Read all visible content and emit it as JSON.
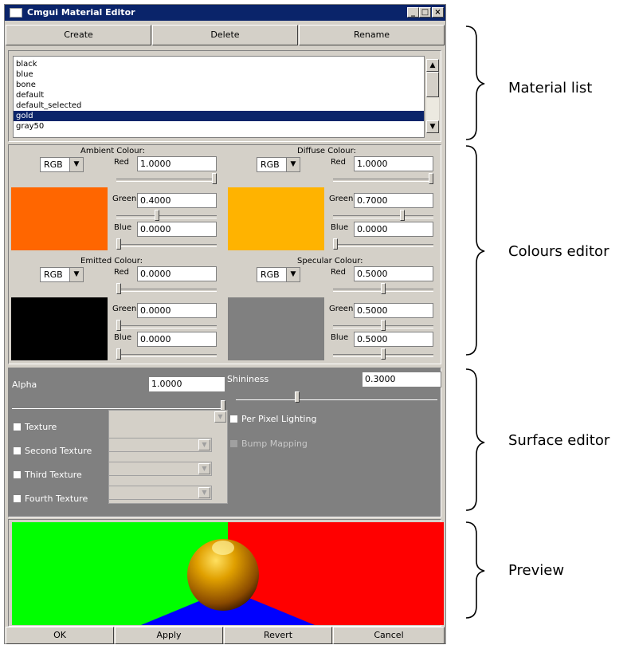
{
  "window": {
    "title": "Cmgui Material Editor",
    "min": "_",
    "max": "□",
    "close": "×"
  },
  "toolbar": {
    "create": "Create",
    "delete": "Delete",
    "rename": "Rename"
  },
  "materials": {
    "items": [
      "black",
      "blue",
      "bone",
      "default",
      "default_selected",
      "gold",
      "gray50"
    ],
    "selected": "gold"
  },
  "colours": {
    "ambient": {
      "title": "Ambient Colour:",
      "mode": "RGB",
      "red_label": "Red",
      "green_label": "Green",
      "blue_label": "Blue",
      "red": "1.0000",
      "green": "0.4000",
      "blue": "0.0000",
      "swatch": "#ff6600",
      "red_level": 1.0,
      "green_level": 0.4,
      "blue_level": 0.0
    },
    "diffuse": {
      "title": "Diffuse Colour:",
      "mode": "RGB",
      "red_label": "Red",
      "green_label": "Green",
      "blue_label": "Blue",
      "red": "1.0000",
      "green": "0.7000",
      "blue": "0.0000",
      "swatch": "#ffb300",
      "red_level": 1.0,
      "green_level": 0.7,
      "blue_level": 0.0
    },
    "emitted": {
      "title": "Emitted Colour:",
      "mode": "RGB",
      "red_label": "Red",
      "green_label": "Green",
      "blue_label": "Blue",
      "red": "0.0000",
      "green": "0.0000",
      "blue": "0.0000",
      "swatch": "#000000",
      "red_level": 0.0,
      "green_level": 0.0,
      "blue_level": 0.0
    },
    "specular": {
      "title": "Specular Colour:",
      "mode": "RGB",
      "red_label": "Red",
      "green_label": "Green",
      "blue_label": "Blue",
      "red": "0.5000",
      "green": "0.5000",
      "blue": "0.5000",
      "swatch": "#808080",
      "red_level": 0.5,
      "green_level": 0.5,
      "blue_level": 0.5
    }
  },
  "surface": {
    "alpha_label": "Alpha",
    "alpha": "1.0000",
    "alpha_level": 1.0,
    "shininess_label": "Shininess",
    "shininess": "0.3000",
    "shininess_level": 0.3,
    "textures": [
      "Texture",
      "Second Texture",
      "Third Texture",
      "Fourth Texture"
    ],
    "per_pixel": "Per Pixel Lighting",
    "bump": "Bump Mapping"
  },
  "preview": {
    "left": "#00ff00",
    "right": "#ff0000",
    "floor": "#0000ff",
    "sphere": "#d48a00"
  },
  "footer": {
    "ok": "OK",
    "apply": "Apply",
    "revert": "Revert",
    "cancel": "Cancel"
  },
  "annotations": {
    "material_list": "Material list",
    "colours_editor": "Colours editor",
    "surface_editor": "Surface editor",
    "preview": "Preview"
  }
}
